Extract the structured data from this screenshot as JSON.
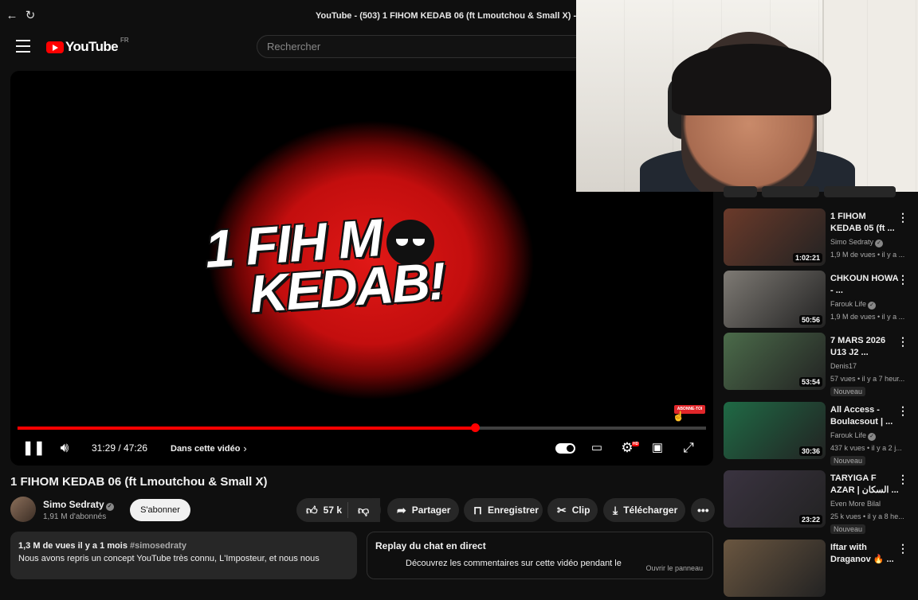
{
  "browser": {
    "back_icon": "arrow-left-icon",
    "reload_icon": "reload-icon",
    "window_title": "YouTube - (503) 1 FIHOM KEDAB 06 (ft Lmoutchou & Small X) - YouTube"
  },
  "header": {
    "logo_text": "YouTube",
    "country_code": "FR",
    "search_placeholder": "Rechercher"
  },
  "player": {
    "thumbnail_line1": "1 FIH  M",
    "thumbnail_line2": "KEDAB!",
    "subscribe_badge": "ABONNE-TOI",
    "current_time": "31:29 / 47:26",
    "chapter_label": "Dans cette vidéo",
    "progress_fraction": 0.664,
    "accent_color": "#ff0000"
  },
  "video": {
    "title": "1 FIHOM KEDAB 06 (ft Lmoutchou & Small X)",
    "channel_name": "Simo Sedraty",
    "subscribers": "1,91 M d'abonnés",
    "subscribe_label": "S'abonner",
    "likes": "57 k",
    "share_label": "Partager",
    "save_label": "Enregistrer",
    "clip_label": "Clip",
    "download_label": "Télécharger"
  },
  "description": {
    "meta": "1,3 M de vues  il y a 1 mois",
    "hashtag": "#simosedraty",
    "text": "Nous avons repris un concept YouTube très connu, L'Imposteur, et nous nous"
  },
  "chat": {
    "title": "Replay du chat en direct",
    "text": "Découvrez les commentaires sur cette vidéo pendant le",
    "button": "Ouvrir le panneau"
  },
  "recommendations": [
    {
      "title": "1 FIHOM KEDAB 05 (ft ...",
      "channel": "Simo Sedraty",
      "verified": true,
      "meta": "1,9 M de vues • il y a ...",
      "duration": "1:02:21",
      "badge": "",
      "thumb_color": "#6b3a2a"
    },
    {
      "title": "CHKOUN HOWA - ...",
      "channel": "Farouk Life",
      "verified": true,
      "meta": "1,9 M de vues • il y a ...",
      "duration": "50:56",
      "badge": "",
      "thumb_color": "#7e7a74"
    },
    {
      "title": "7 MARS 2026 U13 J2 ...",
      "channel": "Denis17",
      "verified": false,
      "meta": "57 vues • il y a 7 heur...",
      "duration": "53:54",
      "badge": "Nouveau",
      "thumb_color": "#4b6b4a"
    },
    {
      "title": "All Access - Boulacsout | ...",
      "channel": "Farouk Life",
      "verified": true,
      "meta": "437 k vues • il y a 2 j...",
      "duration": "30:36",
      "badge": "Nouveau",
      "thumb_color": "#1f6a45"
    },
    {
      "title": "TARYIGA F AZAR | السكان ...",
      "channel": "Even More Bilal",
      "verified": false,
      "meta": "25 k vues • il y a 8 he...",
      "duration": "23:22",
      "badge": "Nouveau",
      "thumb_color": "#3a3340"
    },
    {
      "title": "Iftar with Draganov 🔥 ...",
      "channel": "",
      "verified": false,
      "meta": "",
      "duration": "",
      "badge": "",
      "thumb_color": "#6a5640"
    }
  ]
}
